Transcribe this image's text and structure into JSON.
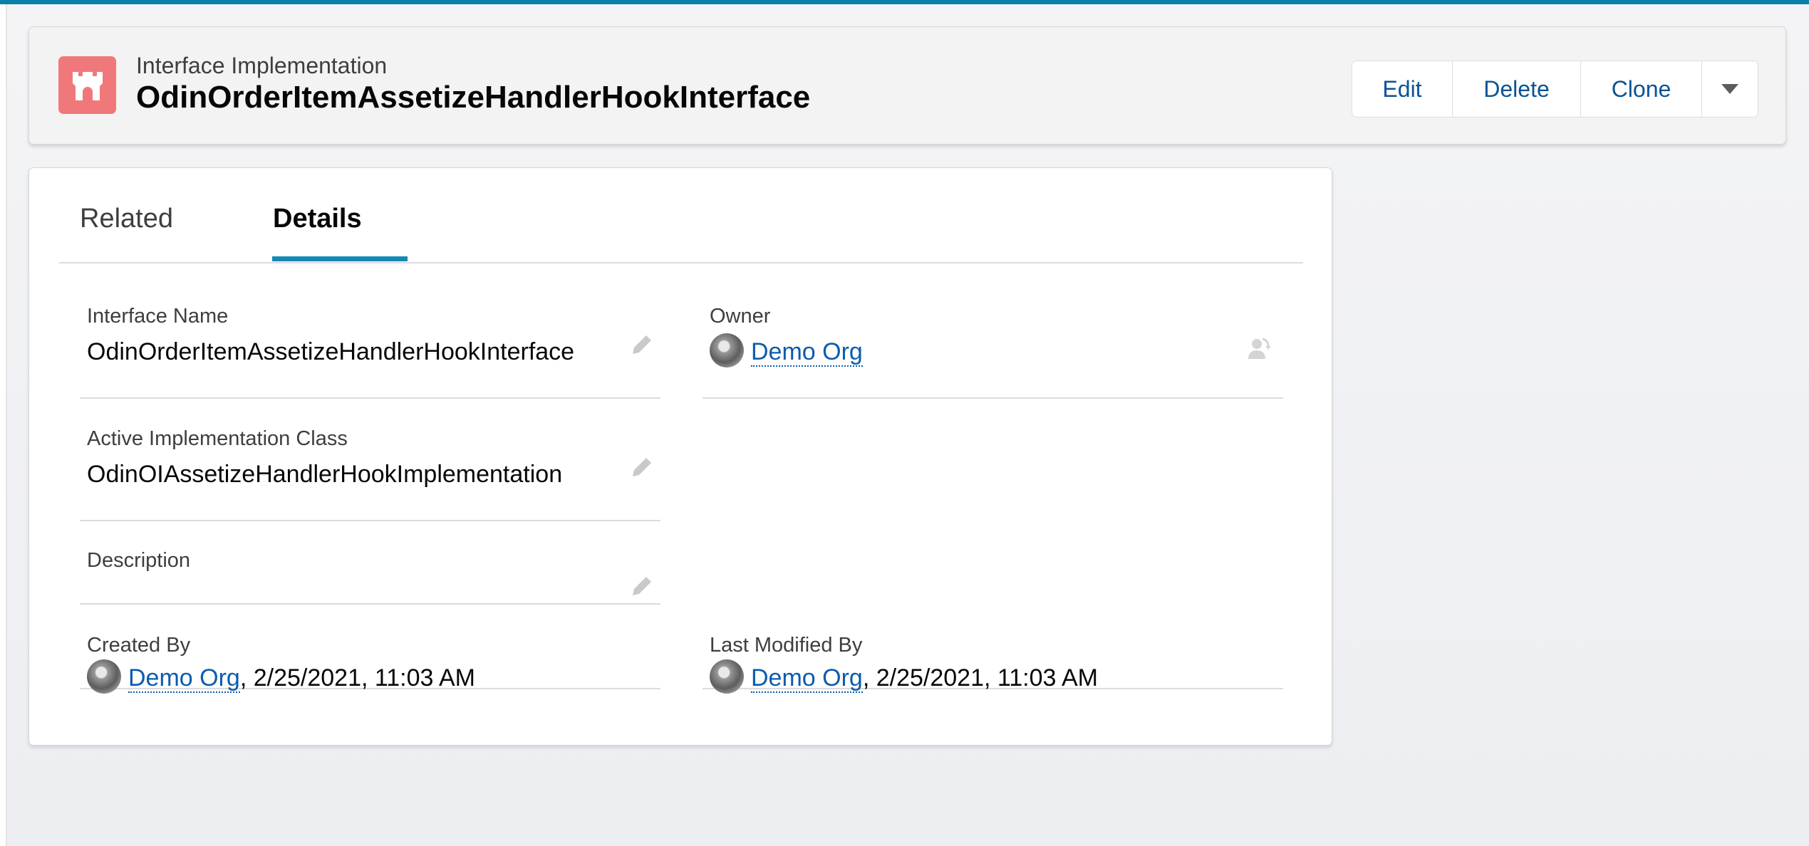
{
  "header": {
    "object_type": "Interface Implementation",
    "record_name": "OdinOrderItemAssetizeHandlerHookInterface",
    "icon": "castle-icon",
    "icon_color": "#f0787a",
    "actions": {
      "edit": "Edit",
      "delete": "Delete",
      "clone": "Clone",
      "more_icon": "chevron-down-icon"
    }
  },
  "tabs": [
    {
      "label": "Related",
      "active": false
    },
    {
      "label": "Details",
      "active": true
    }
  ],
  "fields": {
    "interface_name": {
      "label": "Interface Name",
      "value": "OdinOrderItemAssetizeHandlerHookInterface"
    },
    "owner": {
      "label": "Owner",
      "value": "Demo Org"
    },
    "active_impl": {
      "label": "Active Implementation Class",
      "value": "OdinOIAssetizeHandlerHookImplementation"
    },
    "description": {
      "label": "Description",
      "value": ""
    },
    "created_by": {
      "label": "Created By",
      "user": "Demo Org",
      "datetime": ", 2/25/2021, 11:03 AM"
    },
    "last_modified_by": {
      "label": "Last Modified By",
      "user": "Demo Org",
      "datetime": ", 2/25/2021, 11:03 AM"
    }
  },
  "colors": {
    "accent": "#1589b3",
    "link": "#0b5cad",
    "top_strip": "#0a7fa8"
  }
}
